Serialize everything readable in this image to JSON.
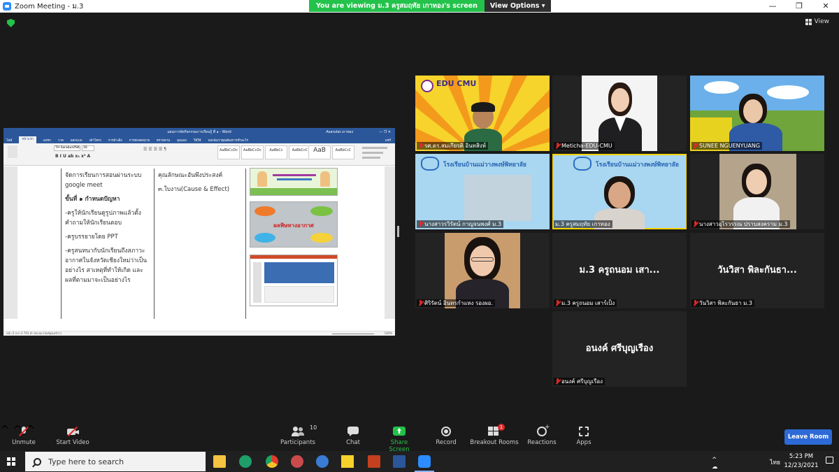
{
  "window": {
    "title": "Zoom Meeting - ม.3"
  },
  "banner": {
    "viewing_text": "You are viewing ม.3 ครูสมฤทัย เกาทอง's screen",
    "view_options": "View Options"
  },
  "view_button": "View",
  "word": {
    "title": "แผนการจัดกิจกรรมการเรียนรู้ ที่ ๑ - Word",
    "user": "Asarutai เกาทอง",
    "tabs": [
      "ไฟล์",
      "หน้าแรก",
      "แทรก",
      "วาด",
      "ออกแบบ",
      "เค้าโครง",
      "การอ้างอิง",
      "การส่งจดหมาย",
      "ตรวจทาน",
      "มุมมอง",
      "วิธีใช้",
      "บอกฉันว่าคุณต้องการทำอะไร"
    ],
    "share": "แชร์",
    "font_name": "TH SarabunPSK",
    "font_size": "16",
    "styles": [
      "AaBbCcDc",
      "AaBbCcDc",
      "AaBbCc",
      "AaBbCcC",
      "AaB",
      "AaBbCcC"
    ],
    "col1": {
      "l1": "จัดการเรียนการสอนผ่านระบบ",
      "l2": "google meet",
      "step": "ขั้นที่ ๑  กำหนดปัญหา",
      "b1a": "-ครูให้นักเรียนดูรูปภาพแล้วตั้ง",
      "b1b": "คำถามให้นักเรียนตอบ",
      "b2": "-ครูบรรยายโดย PPT",
      "b3a": "-ครูสนทนากับนักเรียนถึงสภาวะ",
      "b3b": "อากาศในจังหวัดเชียงใหม่ว่าเป็น",
      "b3c": "อย่างไร สาเหตุที่ทำให้เกิด และ",
      "b3d": "ผลที่ตามมาจะเป็นอย่างไร"
    },
    "col2": {
      "l1": "คุณลักษณะอันพึงประสงค์",
      "l2": "๓.ใบงาน(Cause & Effect)"
    },
    "slide2_text": "ผลพิษทางอากาศ",
    "status": "หน้า 2 จาก 4    791 คำ    อังกฤษ (สหรัฐอเมริกา)",
    "zoom": "140%"
  },
  "participants": [
    {
      "name": "รศ.ดร.สมเกียรติ อินทสิงห์",
      "muted": true,
      "logo": "EDU CMU"
    },
    {
      "name": "Meticha-EDU-CMU",
      "muted": true
    },
    {
      "name": "SUNEE NGUENYUANG",
      "muted": true
    },
    {
      "name": "นางสาวรวิรัตน์ กาญจนพงศ์ ม.3",
      "muted": true,
      "logo": "โรงเรียนบ้านแม่วางพงษ์พิทยาลัย"
    },
    {
      "name": "ม.3 ครูสมฤทัย เกาทอง",
      "muted": false,
      "logo": "โรงเรียนบ้านแม่วางพงษ์พิทยาลัย"
    },
    {
      "name": "นางสาวอุไรวรรณ ปราบสงคราม ม.3",
      "muted": true
    },
    {
      "name": "ศิริรัตน์ อินทรกำแหง รองผอ.",
      "muted": true
    },
    {
      "name": "ม.3 ครูถนอม เสาร์เป็ง",
      "muted": true,
      "big": "ม.3 ครูถนอม เสา..."
    },
    {
      "name": "วันวิสา พิละกันธา ม.3",
      "muted": true,
      "big": "วันวิสา พิละกันธา..."
    },
    {
      "name": "อนงค์ ศรีบุญเรือง",
      "muted": true,
      "big": "อนงค์ ศรีบุญเรือง"
    }
  ],
  "controls": {
    "unmute": "Unmute",
    "start_video": "Start Video",
    "participants": "Participants",
    "participants_count": "10",
    "chat": "Chat",
    "share_screen": "Share Screen",
    "record": "Record",
    "breakout_rooms": "Breakout Rooms",
    "breakout_badge": "1",
    "reactions": "Reactions",
    "apps": "Apps",
    "leave": "Leave Room"
  },
  "taskbar": {
    "search_placeholder": "Type here to search",
    "lang": "ไทย",
    "time": "5:23 PM",
    "date": "12/23/2021"
  },
  "colors": {
    "zoom_blue": "#2d8cff",
    "green": "#23c24a",
    "active_speaker": "#f5d300",
    "word_blue": "#2b579a",
    "leave_blue": "#2d6ad6"
  }
}
